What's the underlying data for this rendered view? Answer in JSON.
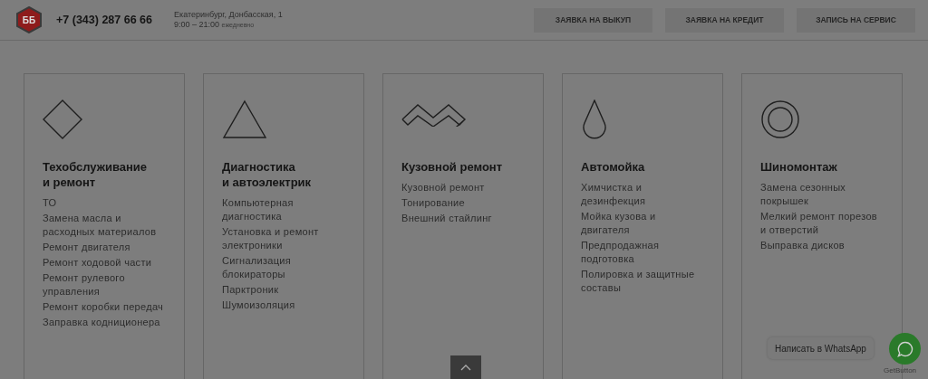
{
  "header": {
    "logo": "ББ",
    "phone": "+7 (343) 287 66 66",
    "address": "Екатеринбург, Донбасская, 1",
    "hours": "9:00 – 21:00",
    "hours_note": "ежедневно",
    "buttons": [
      "ЗАЯВКА НА ВЫКУП",
      "ЗАЯВКА НА КРЕДИТ",
      "ЗАПИСЬ НА СЕРВИС"
    ]
  },
  "services": [
    {
      "title": "Техобслуживание\nи ремонт",
      "items": [
        "ТО",
        "Замена масла и расходных материалов",
        "Ремонт двигателя",
        "Ремонт ходовой части",
        "Ремонт рулевого управления",
        "Ремонт коробки передач",
        "Заправка кодниционера"
      ]
    },
    {
      "title": "Диагностика\nи автоэлектрик",
      "items": [
        "Компьютерная диагностика",
        "Установка и ремонт электроники",
        "Сигнализация блокираторы",
        "Парктроник",
        "Шумоизоляция"
      ]
    },
    {
      "title": "Кузовной ремонт",
      "items": [
        "Кузовной ремонт",
        "Тонирование",
        "Внешний стайлинг"
      ]
    },
    {
      "title": "Автомойка",
      "items": [
        "Химчистка и дезинфекция",
        "Мойка кузова и двигателя",
        "Предпродажная подготовка",
        "Полировка и защитные составы"
      ]
    },
    {
      "title": "Шиномонтаж",
      "items": [
        "Замена сезонных покрышек",
        "Мелкий ремонт порезов и отверстий",
        "Выправка дисков"
      ]
    }
  ],
  "whatsapp": {
    "label": "Написать в WhatsApp",
    "credit": "GetButton"
  }
}
